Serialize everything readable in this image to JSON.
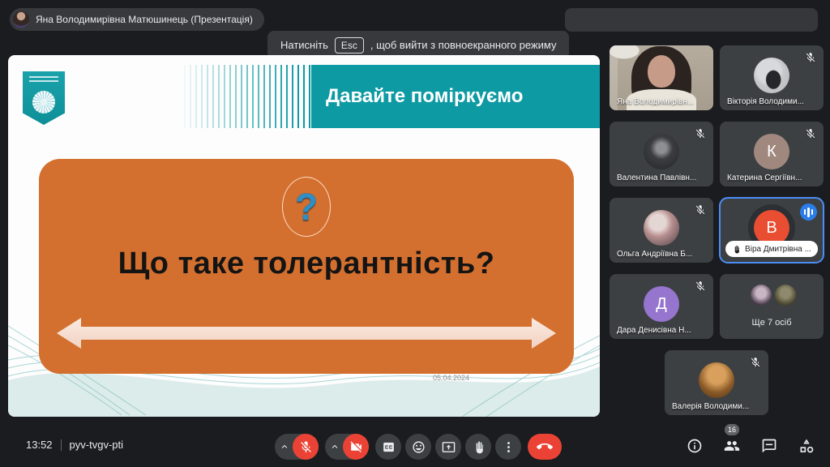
{
  "top": {
    "presenter_chip": "Яна Володимирівна Матюшинець (Презентація)",
    "esc_prefix": "Натисніть",
    "esc_key": "Esc",
    "esc_suffix": ", щоб вийти з повноекранного режиму"
  },
  "slide": {
    "header_title": "Давайте поміркуємо",
    "question_mark": "?",
    "question": "Що таке толерантність?",
    "date": "05.04.2024"
  },
  "participants": [
    {
      "name": "Яна Володимирівн...",
      "type": "video",
      "muted": false
    },
    {
      "name": "Вікторія Володими...",
      "type": "photo",
      "muted": true
    },
    {
      "name": "Валентина Павлівн...",
      "type": "photo",
      "muted": true
    },
    {
      "name": "Катерина Сергіївн...",
      "type": "letter",
      "letter": "К",
      "letter_color": "#a1887f",
      "muted": true
    },
    {
      "name": "Ольга Андріївна Б...",
      "type": "photo",
      "muted": true
    },
    {
      "name": "Віра Дмитрівна ...",
      "type": "letter",
      "letter": "В",
      "letter_color": "#e94d32",
      "muted": false,
      "active_speaker": true,
      "hand_raised": true
    },
    {
      "name": "Дара Денисівна Н...",
      "type": "letter",
      "letter": "Д",
      "letter_color": "#9575cd",
      "muted": true
    },
    {
      "name": "Ще 7 осіб",
      "type": "overflow"
    },
    {
      "name": "Валерія Володими...",
      "type": "photo",
      "muted": true
    }
  ],
  "bottom": {
    "time": "13:52",
    "code": "pyv-tvgv-pti",
    "people_count": "16"
  },
  "colors": {
    "danger_red": "#ea4335",
    "active_tile_border": "#4c8df6",
    "speaker_indicator_blue": "#2b7de9",
    "tile_background": "#3c4043",
    "slide_teal": "#0d9aa3",
    "slide_orange": "#d4702f"
  }
}
